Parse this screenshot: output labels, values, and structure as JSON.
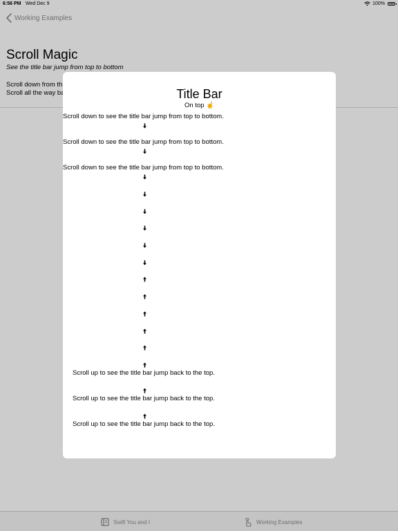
{
  "status_bar": {
    "time": "6:56 PM",
    "date": "Wed Dec 9",
    "battery": "100%"
  },
  "nav": {
    "back_label": "Working Examples"
  },
  "header": {
    "title": "Scroll Magic",
    "subtitle": "See the title bar jump from top to bottom",
    "description_line1": "Scroll down from th",
    "description_line2": "Scroll all the way ba"
  },
  "sheet": {
    "title": "Title Bar",
    "subtitle": "On top ☝️",
    "scroll_down_text": "Scroll down to see the title bar jump from top to bottom.",
    "scroll_up_text": "Scroll up to see the title bar jump back to the top."
  },
  "tabs": [
    {
      "label": "Swift You and I",
      "icon": "book-icon"
    },
    {
      "label": "Working Examples",
      "icon": "hand-tap-icon"
    }
  ],
  "colors": {
    "overlay": "rgba(0,0,0,0.2)",
    "secondary_text": "#8a8a8a"
  }
}
